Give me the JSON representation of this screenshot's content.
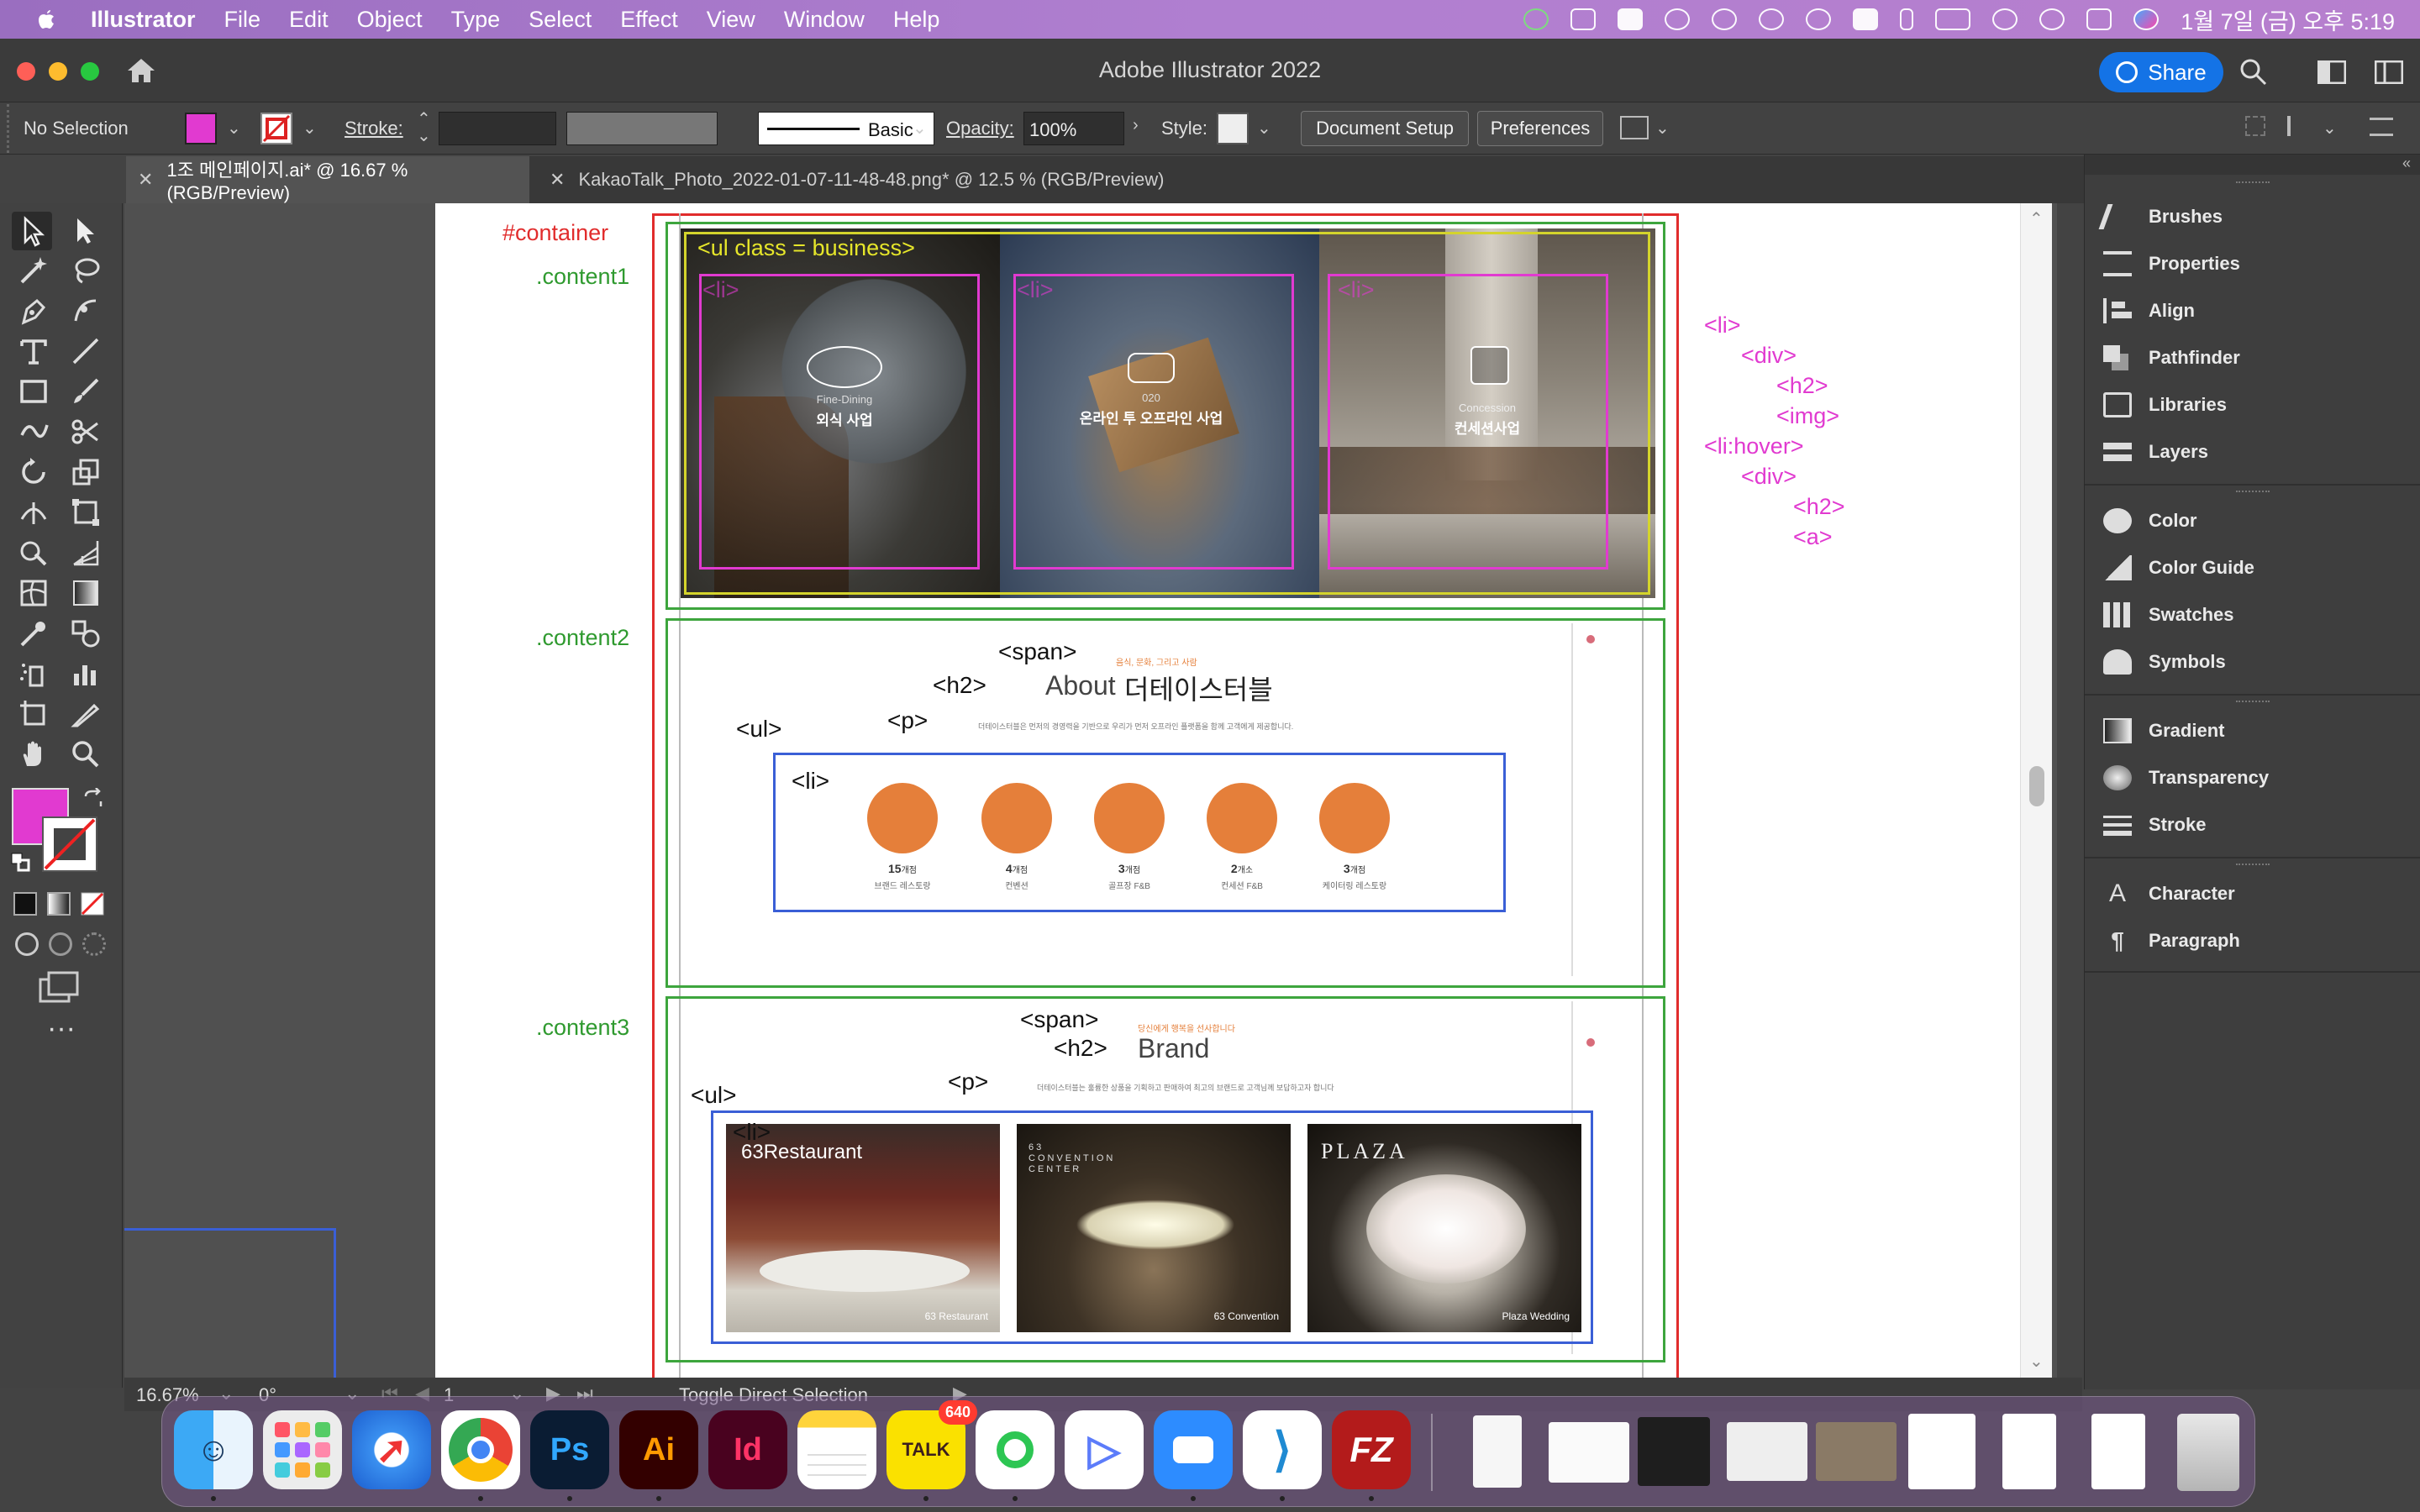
{
  "menubar": {
    "app": "Illustrator",
    "menus": [
      "File",
      "Edit",
      "Object",
      "Type",
      "Select",
      "Effect",
      "View",
      "Window",
      "Help"
    ],
    "clock": "1월 7일 (금) 오후 5:19",
    "status_icons": [
      "jamf-icon",
      "input-icon",
      "zoom-icon",
      "chat-icon",
      "cloud-icon",
      "play-icon",
      "airdrop-icon",
      "keyboard-a-icon",
      "bluetooth-icon",
      "battery-icon",
      "wifi-icon",
      "spotlight-icon",
      "control-center-icon",
      "siri-icon"
    ]
  },
  "window": {
    "title": "Adobe Illustrator 2022",
    "share_label": "Share"
  },
  "controlbar": {
    "selection": "No Selection",
    "fill_color": "#e13ad0",
    "stroke_label": "Stroke:",
    "brush_label": "Basic",
    "opacity_label": "Opacity:",
    "opacity_value": "100%",
    "style_label": "Style:",
    "document_setup": "Document Setup",
    "preferences": "Preferences"
  },
  "tabs": [
    {
      "label": "1조 메인페이지.ai* @ 16.67 % (RGB/Preview)",
      "active": true
    },
    {
      "label": "KakaoTalk_Photo_2022-01-07-11-48-48.png* @ 12.5 % (RGB/Preview)",
      "active": false
    }
  ],
  "artboard": {
    "container_label": "#container",
    "content1_label": ".content1",
    "content2_label": ".content2",
    "content3_label": ".content3",
    "ul_business": "<ul class = business>",
    "li_tag": "<li>",
    "ul_tag": "<ul>",
    "span_tag": "<span>",
    "h2_tag": "<h2>",
    "p_tag": "<p>",
    "cards": [
      {
        "sub": "Fine-Dining",
        "title": "외식 사업"
      },
      {
        "sub": "020",
        "title": "온라인 투 오프라인 사업"
      },
      {
        "sub": "Concession",
        "title": "컨세션사업"
      }
    ],
    "about": {
      "span": "음식, 문화, 그리고 사람",
      "title_en": "About",
      "title_ko": "더테이스터블",
      "desc": "더테이스터블은 먼저의 경영력을 기반으로 우리가 먼저 오프라인 플랫폼을 함께 고객에게 제공합니다."
    },
    "stats": [
      {
        "count": "15",
        "unit": "개점",
        "label": "브랜드 레스토랑"
      },
      {
        "count": "4",
        "unit": "개점",
        "label": "컨벤션"
      },
      {
        "count": "3",
        "unit": "개점",
        "label": "골프장 F&B"
      },
      {
        "count": "2",
        "unit": "개소",
        "label": "컨세션 F&B"
      },
      {
        "count": "3",
        "unit": "개점",
        "label": "케이터링 레스토랑"
      }
    ],
    "brand": {
      "span": "당신에게 행복을 선사합니다",
      "title": "Brand",
      "desc": "더테이스터블는 훌륭한 상품을 기획하고 판매하여 최고의 브랜드로 고객님께 보답하고자 합니다"
    },
    "brands": [
      {
        "logo": "63Restaurant",
        "caption": "63 Restaurant"
      },
      {
        "logo": "63 CONVENTION CENTER",
        "caption": "63 Convention"
      },
      {
        "logo": "PLAZA",
        "caption": "Plaza Wedding"
      }
    ],
    "side_note": [
      "<li>",
      "<div>",
      "<h2>",
      "<img>",
      "<li:hover>",
      "<div>",
      "<h2>",
      "<a>"
    ]
  },
  "panels": {
    "group1": [
      "Brushes",
      "Properties",
      "Align",
      "Pathfinder",
      "Libraries",
      "Layers"
    ],
    "group2": [
      "Color",
      "Color Guide",
      "Swatches",
      "Symbols"
    ],
    "group3": [
      "Gradient",
      "Transparency",
      "Stroke"
    ],
    "group4": [
      "Character",
      "Paragraph"
    ]
  },
  "statusbar": {
    "zoom": "16.67%",
    "rotate": "0°",
    "page": "1",
    "tool": "Toggle Direct Selection"
  },
  "dock": {
    "badge": "640",
    "apps": [
      "Finder",
      "Launchpad",
      "Safari",
      "Chrome",
      "Photoshop",
      "Illustrator",
      "InDesign",
      "Notes",
      "KakaoTalk",
      "Open",
      "Play",
      "Zoom",
      "VS Code",
      "FileZilla"
    ],
    "ps_label": "Ps",
    "ai_label": "Ai",
    "id_label": "Id",
    "talk_label": "TALK",
    "fz_label": "FZ"
  }
}
